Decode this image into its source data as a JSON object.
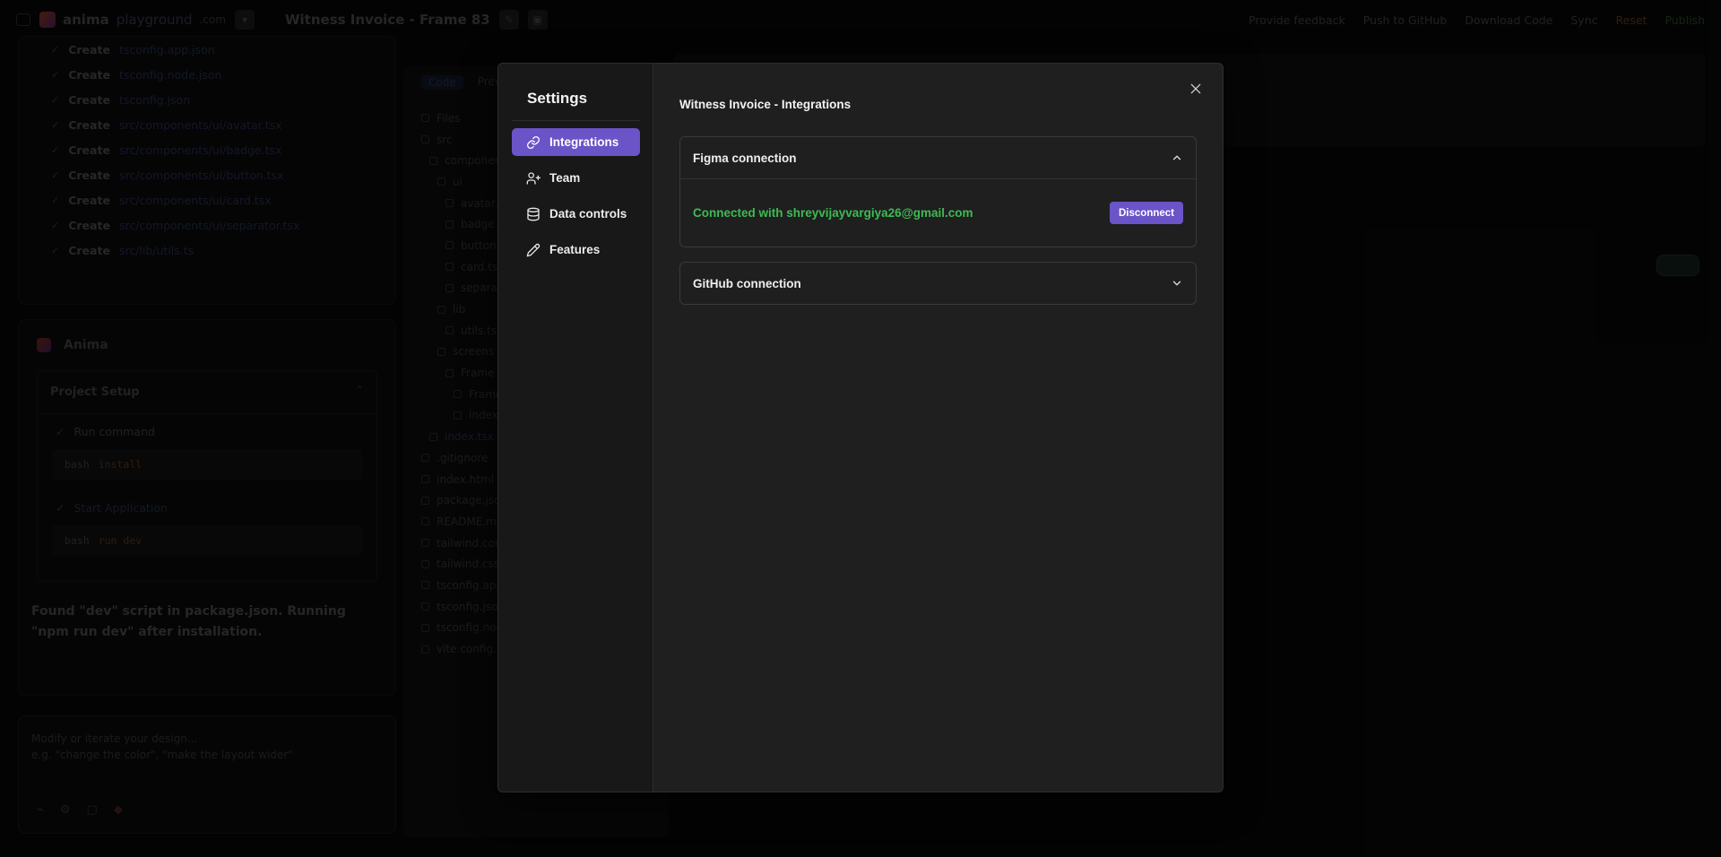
{
  "background": {
    "brand": {
      "name": "anima",
      "sub": "playground",
      "domain": ".com"
    },
    "project_title": "Witness Invoice - Frame 83",
    "topbar_actions": [
      "Provide feedback",
      "Push to GitHub",
      "Download Code",
      "Sync",
      "Reset",
      "Publish"
    ],
    "create_rows": [
      {
        "label": "Create",
        "path": "tsconfig.app.json"
      },
      {
        "label": "Create",
        "path": "tsconfig.node.json"
      },
      {
        "label": "Create",
        "path": "tsconfig.json"
      },
      {
        "label": "Create",
        "path": "src/components/ui/avatar.tsx"
      },
      {
        "label": "Create",
        "path": "src/components/ui/badge.tsx"
      },
      {
        "label": "Create",
        "path": "src/components/ui/button.tsx"
      },
      {
        "label": "Create",
        "path": "src/components/ui/card.tsx"
      },
      {
        "label": "Create",
        "path": "src/components/ui/separator.tsx"
      },
      {
        "label": "Create",
        "path": "src/lib/utils.ts"
      }
    ],
    "anima_panel": {
      "name": "Anima",
      "setup_title": "Project Setup",
      "step1": "Run command",
      "cmd1_prompt": "bash",
      "cmd1": "install",
      "step2": "Start Application",
      "cmd2_prompt": "bash",
      "cmd2": "run dev",
      "note": "Found \"dev\" script in package.json. Running \"npm run dev\" after installation."
    },
    "prompt": {
      "placeholder_line1": "Modify or iterate your design...",
      "placeholder_line2": "e.g. \"change the color\", \"make the layout wider\""
    },
    "file_tabs": [
      "Code",
      "Preview"
    ],
    "files": [
      "Files",
      "src",
      "components",
      "ui",
      "avatar.tsx",
      "badge.tsx",
      "button.tsx",
      "card.tsx",
      "separator.tsx",
      "lib",
      "utils.ts",
      "screens",
      "Frame",
      "Frame.tsx",
      "index.ts",
      "index.tsx",
      ".gitignore",
      "index.html",
      "package.json",
      "README.md",
      "tailwind.config.js",
      "tailwind.css",
      "tsconfig.app.json",
      "tsconfig.json",
      "tsconfig.node.json",
      "vite.config.ts"
    ]
  },
  "settings": {
    "title": "Settings",
    "nav": [
      {
        "label": "Integrations",
        "icon": "link-icon",
        "active": true
      },
      {
        "label": "Team",
        "icon": "user-plus-icon",
        "active": false
      },
      {
        "label": "Data controls",
        "icon": "database-icon",
        "active": false
      },
      {
        "label": "Features",
        "icon": "pencil-icon",
        "active": false
      }
    ],
    "main_title": "Witness Invoice - Integrations",
    "figma": {
      "title": "Figma connection",
      "connected_text": "Connected with shreyvijayvargiya26@gmail.com",
      "disconnect_label": "Disconnect"
    },
    "github": {
      "title": "GitHub connection"
    }
  },
  "colors": {
    "accent": "#6a54c8",
    "connected_green": "#3dbb54",
    "modal_bg": "#1f1f1f",
    "sidebar_bg": "#181818"
  }
}
